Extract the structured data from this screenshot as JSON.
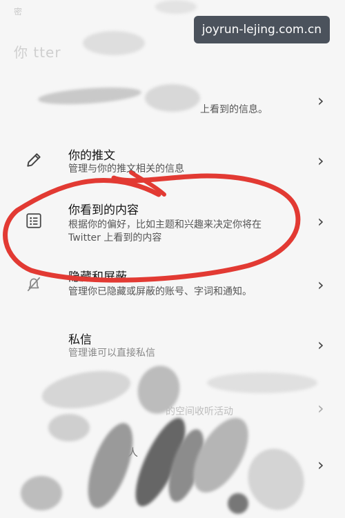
{
  "watermark": "joyrun-lejing.com.cn",
  "header": {
    "faint_text": "密",
    "title_partial": "你 tter"
  },
  "rows": [
    {
      "title": "",
      "desc": "上看到的信息。"
    },
    {
      "icon": "pencil-icon",
      "title": "你的推文",
      "desc": "管理与你的推文相关的信息"
    },
    {
      "icon": "list-icon",
      "title": "你看到的内容",
      "desc_line1": "根据你的偏好，比如主题和兴趣来决定你将在",
      "desc_line2": "Twitter 上看到的内容"
    },
    {
      "icon": "muted-icon",
      "title": "隐藏和屏蔽",
      "desc": "管理你已隐藏或屏蔽的账号、字词和通知。"
    },
    {
      "title": "私信",
      "desc": "管理谁可以直接私信"
    },
    {
      "desc": "的空间收听活动"
    },
    {
      "desc": "的人"
    }
  ],
  "chevron": "›",
  "highlight_color": "#e23a33"
}
